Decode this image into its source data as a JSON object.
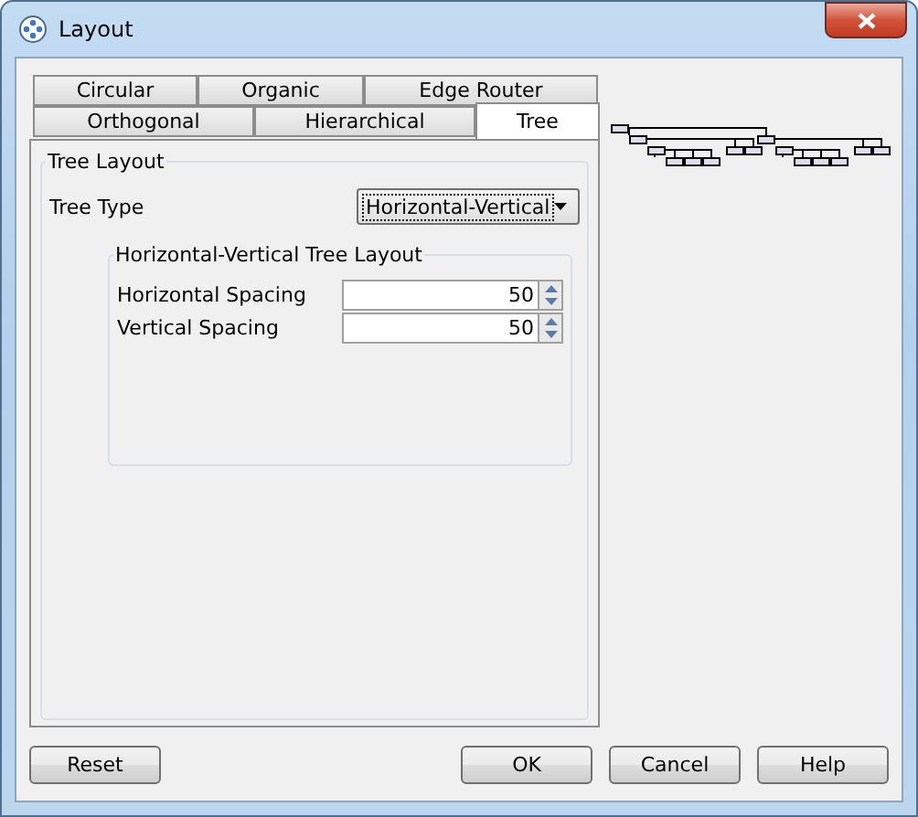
{
  "window": {
    "title": "Layout"
  },
  "tab_rows": [
    [
      {
        "label": "Circular",
        "selected": false
      },
      {
        "label": "Organic",
        "selected": false
      },
      {
        "label": "Edge Router",
        "selected": false
      }
    ],
    [
      {
        "label": "Orthogonal",
        "selected": false
      },
      {
        "label": "Hierarchical",
        "selected": false
      },
      {
        "label": "Tree",
        "selected": true
      }
    ]
  ],
  "tree_layout": {
    "title": "Tree Layout",
    "tree_type": {
      "label": "Tree Type",
      "value": "Horizontal-Vertical"
    },
    "group": {
      "title": "Horizontal-Vertical Tree Layout",
      "fields": [
        {
          "label": "Horizontal Spacing",
          "value": "50"
        },
        {
          "label": "Vertical Spacing",
          "value": "50"
        }
      ]
    }
  },
  "buttons": [
    {
      "label": "Reset",
      "kind": "left"
    },
    {
      "label": "OK",
      "kind": "right"
    },
    {
      "label": "Cancel",
      "kind": "right"
    },
    {
      "label": "Help",
      "kind": "right"
    }
  ]
}
